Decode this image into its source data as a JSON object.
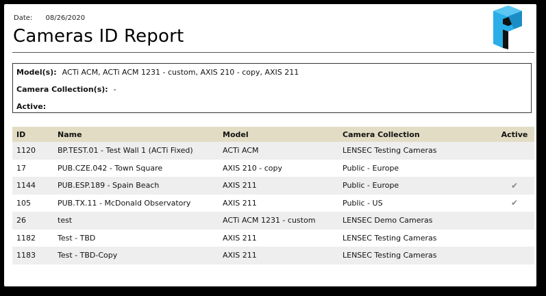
{
  "report": {
    "date_label": "Date:",
    "date_value": "08/26/2020",
    "title": "Cameras ID Report"
  },
  "filters": {
    "models_label": "Model(s):",
    "models_value": "ACTi ACM, ACTi ACM 1231 - custom, AXIS 210 - copy, AXIS 211",
    "collections_label": "Camera Collection(s):",
    "collections_value": "-",
    "active_label": "Active:",
    "active_value": ""
  },
  "table": {
    "headers": [
      "ID",
      "Name",
      "Model",
      "Camera Collection",
      "Active"
    ],
    "rows": [
      {
        "id": "1120",
        "name": "BP.TEST.01 - Test Wall 1 (ACTi Fixed)",
        "model": "ACTi ACM",
        "collection": "LENSEC Testing Cameras",
        "active": ""
      },
      {
        "id": "17",
        "name": "PUB.CZE.042 - Town Square",
        "model": "AXIS 210 - copy",
        "collection": "Public - Europe",
        "active": ""
      },
      {
        "id": "1144",
        "name": "PUB.ESP.189 - Spain Beach",
        "model": "AXIS 211",
        "collection": "Public - Europe",
        "active": "✔"
      },
      {
        "id": "105",
        "name": "PUB.TX.11 - McDonald Observatory",
        "model": "AXIS 211",
        "collection": "Public - US",
        "active": "✔"
      },
      {
        "id": "26",
        "name": "test",
        "model": "ACTi ACM 1231 - custom",
        "collection": "LENSEC Demo Cameras",
        "active": ""
      },
      {
        "id": "1182",
        "name": "Test - TBD",
        "model": "AXIS 211",
        "collection": "LENSEC Testing Cameras",
        "active": ""
      },
      {
        "id": "1183",
        "name": "Test - TBD-Copy",
        "model": "AXIS 211",
        "collection": "LENSEC Testing Cameras",
        "active": ""
      }
    ]
  },
  "icons": {
    "logo": "brand-p-logo-icon",
    "active_mark": "checkmark-icon"
  },
  "colors": {
    "header_bg": "#e2dcc4",
    "row_alt_bg": "#eeeeee",
    "logo_light": "#29aee8",
    "logo_dark": "#111111"
  }
}
